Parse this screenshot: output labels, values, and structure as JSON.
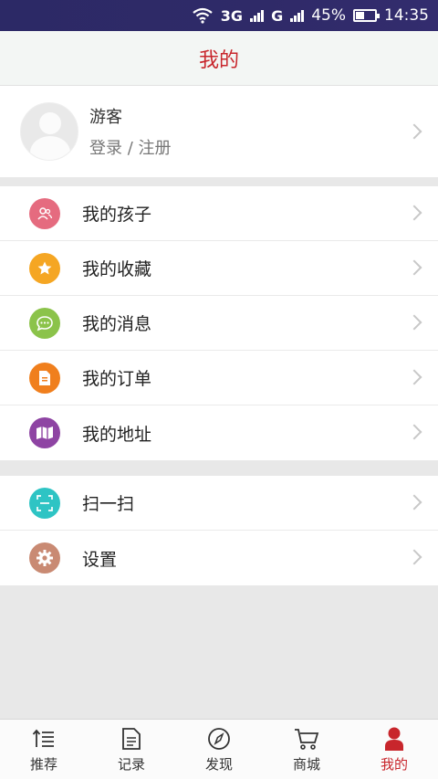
{
  "status_bar": {
    "network1": "3G",
    "network2": "G",
    "battery_percent": "45%",
    "battery_level": 0.45,
    "time": "14:35"
  },
  "header": {
    "title": "我的"
  },
  "profile": {
    "name": "游客",
    "login_text": "登录 / 注册"
  },
  "menu_group1": [
    {
      "label": "我的孩子",
      "icon": "children-icon",
      "color": "#e56b7f"
    },
    {
      "label": "我的收藏",
      "icon": "star-icon",
      "color": "#f5a623"
    },
    {
      "label": "我的消息",
      "icon": "message-icon",
      "color": "#8bc34a"
    },
    {
      "label": "我的订单",
      "icon": "order-icon",
      "color": "#f07f1d"
    },
    {
      "label": "我的地址",
      "icon": "map-icon",
      "color": "#8e44a3"
    }
  ],
  "menu_group2": [
    {
      "label": "扫一扫",
      "icon": "scan-icon",
      "color": "#2ec4c4"
    },
    {
      "label": "设置",
      "icon": "gear-icon",
      "color": "#c98a73"
    }
  ],
  "tabs": [
    {
      "label": "推荐",
      "icon": "recommend-icon"
    },
    {
      "label": "记录",
      "icon": "record-icon"
    },
    {
      "label": "发现",
      "icon": "compass-icon"
    },
    {
      "label": "商城",
      "icon": "cart-icon"
    },
    {
      "label": "我的",
      "icon": "user-icon",
      "active": true
    }
  ],
  "colors": {
    "accent": "#c8262c"
  }
}
